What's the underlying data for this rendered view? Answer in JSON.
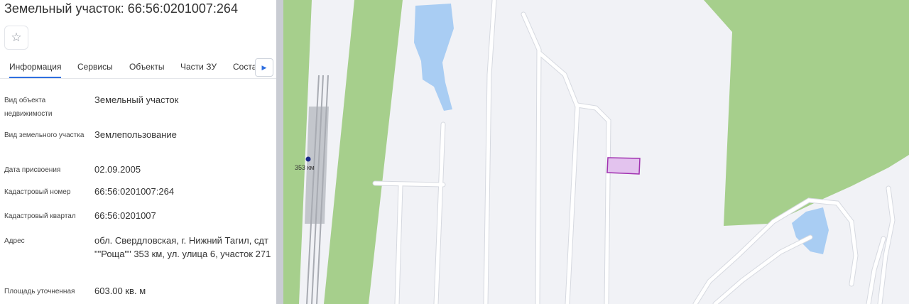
{
  "title": "Земельный участок: 66:56:0201007:264",
  "tabs": [
    "Информация",
    "Сервисы",
    "Объекты",
    "Части ЗУ",
    "Соста"
  ],
  "fields": [
    {
      "label": "Вид объекта недвижимости",
      "value": "Земельный участок"
    },
    {
      "label": "Вид земельного участка",
      "value": "Землепользование"
    },
    {
      "label": "Дата присвоения",
      "value": "02.09.2005"
    },
    {
      "label": "Кадастровый номер",
      "value": "66:56:0201007:264"
    },
    {
      "label": "Кадастровый квартал",
      "value": "66:56:0201007"
    },
    {
      "label": "Адрес",
      "value": "обл. Свердловская, г. Нижний Тагил, сдт \"\"Роща\"\" 353 км, ул. улица 6, участок 271"
    },
    {
      "label": "Площадь уточненная",
      "value": "603.00 кв. м"
    }
  ],
  "map": {
    "station_label": "353 км",
    "colors": {
      "forest": "#a6cf8c",
      "water": "#a9cdf3",
      "road": "#ffffff",
      "road_edge": "#d6d9e0",
      "rail": "#b2b5bb",
      "parcel_fill": "#e3c3ee",
      "parcel_stroke": "#a132b0",
      "station": "#1a2a8a"
    }
  }
}
